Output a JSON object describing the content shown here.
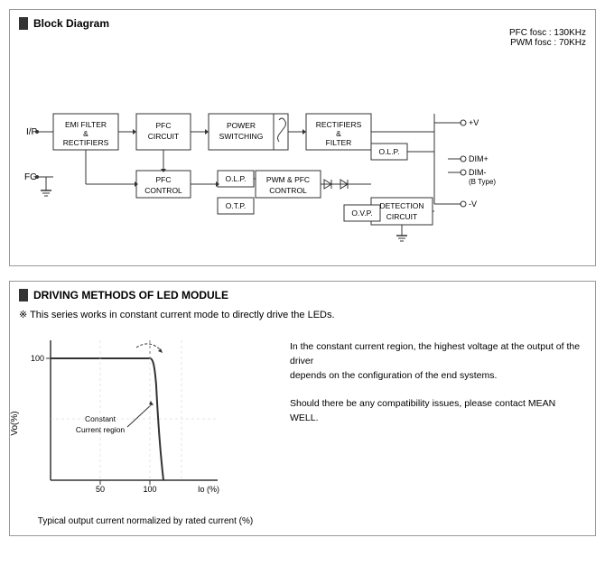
{
  "blockDiagram": {
    "sectionTitle": "Block Diagram",
    "pfcInfo": {
      "line1": "PFC fosc : 130KHz",
      "line2": "PWM fosc : 70KHz"
    },
    "labels": {
      "ip": "I/P",
      "fg": "FG",
      "emiFilter": "EMI FILTER\n&\nRECTIFIERS",
      "pfcCircuit": "PFC\nCIRCUIT",
      "powerSwitching": "POWER\nSWITCHING",
      "rectifiersFilter": "RECTIFIERS\n&\nFILTER",
      "pfcControl": "PFC\nCONTROL",
      "olp1": "O.L.P.",
      "pwmPfcControl": "PWM & PFC\nCONTROL",
      "olp2": "O.L.P.",
      "otp": "O.T.P.",
      "ovp": "O.V.P.",
      "detectionCircuit": "DETECTION\nCIRCUIT",
      "vPlus": "+V",
      "vMinus": "-V",
      "dimPlus": "DIM+",
      "dimMinus": "DIM-",
      "bType": "(B Type)"
    }
  },
  "drivingMethods": {
    "sectionTitle": "DRIVING METHODS OF LED MODULE",
    "note": "※  This series works in constant current mode to directly drive the LEDs.",
    "chart": {
      "yAxisLabel": "Vo(%)",
      "xAxisLabel": "Io (%)",
      "y100": "100",
      "x50": "50",
      "x100": "100",
      "constantCurrentLabel": "Constant\nCurrent region"
    },
    "description": {
      "line1": "In the constant current region, the highest voltage at the output of the driver",
      "line2": "depends on the configuration of the end systems.",
      "line3": "Should there be any compatibility issues, please contact MEAN WELL."
    },
    "caption": "Typical output current normalized by rated current (%)"
  }
}
